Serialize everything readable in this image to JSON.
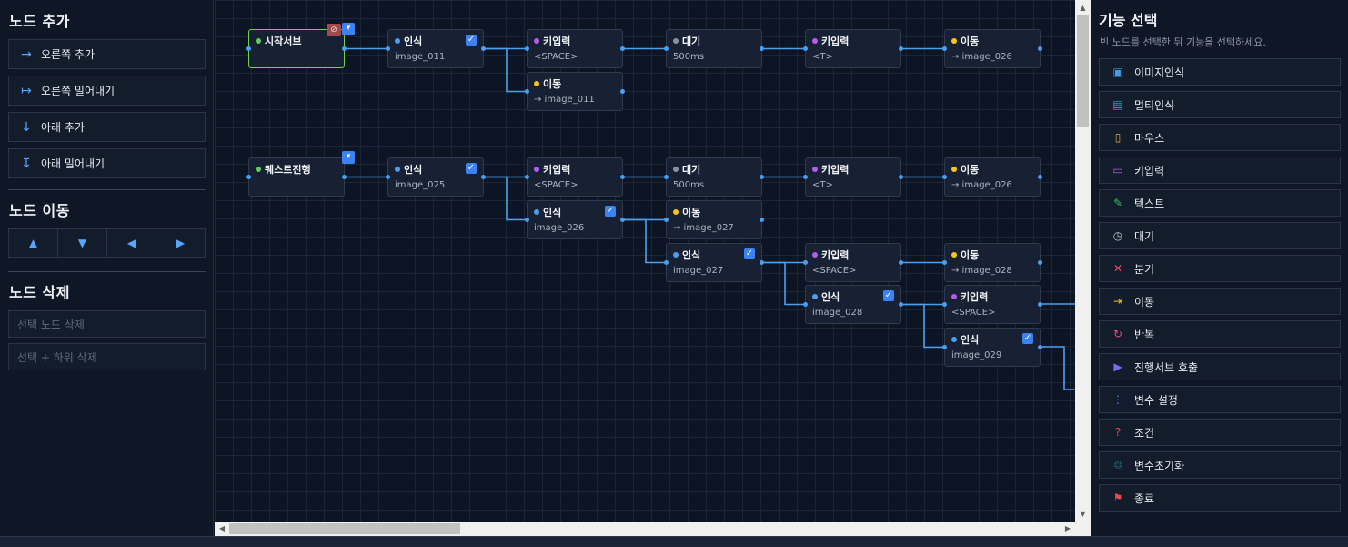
{
  "left": {
    "add_title": "노드 추가",
    "add_buttons": [
      {
        "icon": "arrow-right-icon",
        "glyph": "→",
        "label": "오른쪽 추가"
      },
      {
        "icon": "arrow-push-right-icon",
        "glyph": "↦",
        "label": "오른쪽 밀어내기"
      },
      {
        "icon": "arrow-down-icon",
        "glyph": "↓",
        "label": "아래 추가"
      },
      {
        "icon": "arrow-push-down-icon",
        "glyph": "↧",
        "label": "아래 밀어내기"
      }
    ],
    "move_title": "노드 이동",
    "move_buttons": [
      {
        "icon": "move-up-icon",
        "glyph": "▲"
      },
      {
        "icon": "move-down-icon",
        "glyph": "▼"
      },
      {
        "icon": "move-left-icon",
        "glyph": "◀"
      },
      {
        "icon": "move-right-icon",
        "glyph": "▶"
      }
    ],
    "delete_title": "노드 삭제",
    "delete_buttons": [
      "선택 노드 삭제",
      "선택 + 하위 삭제"
    ]
  },
  "canvas": {
    "colors": {
      "wire": "#4a9ff0",
      "green": "#5ad05a",
      "blue": "#4a9ff0",
      "purple": "#b45cf0",
      "gray": "#8a93a3",
      "yellow": "#f5c518"
    },
    "nodes": [
      {
        "id": "n1",
        "title": "시작서브",
        "sub": "",
        "dot": "green",
        "start": true,
        "check": false
      },
      {
        "id": "n2",
        "title": "인식",
        "sub": "image_011",
        "dot": "blue",
        "check": true
      },
      {
        "id": "n3",
        "title": "키입력",
        "sub": "<SPACE>",
        "dot": "purple",
        "check": false
      },
      {
        "id": "n4",
        "title": "대기",
        "sub": "500ms",
        "dot": "gray",
        "check": false
      },
      {
        "id": "n5",
        "title": "키입력",
        "sub": "<T>",
        "dot": "purple",
        "check": false
      },
      {
        "id": "n6",
        "title": "이동",
        "sub": "→ image_026",
        "dot": "yellow",
        "check": false
      },
      {
        "id": "n7",
        "title": "이동",
        "sub": "→ image_011",
        "dot": "yellow",
        "check": false
      },
      {
        "id": "n8",
        "title": "퀘스트진행",
        "sub": "",
        "dot": "green",
        "check": false
      },
      {
        "id": "n9",
        "title": "인식",
        "sub": "image_025",
        "dot": "blue",
        "check": true
      },
      {
        "id": "n10",
        "title": "키입력",
        "sub": "<SPACE>",
        "dot": "purple",
        "check": false
      },
      {
        "id": "n11",
        "title": "대기",
        "sub": "500ms",
        "dot": "gray",
        "check": false
      },
      {
        "id": "n12",
        "title": "키입력",
        "sub": "<T>",
        "dot": "purple",
        "check": false
      },
      {
        "id": "n13",
        "title": "이동",
        "sub": "→ image_026",
        "dot": "yellow",
        "check": false
      },
      {
        "id": "n14",
        "title": "인식",
        "sub": "image_026",
        "dot": "blue",
        "check": true
      },
      {
        "id": "n15",
        "title": "이동",
        "sub": "→ image_027",
        "dot": "yellow",
        "check": false
      },
      {
        "id": "n16",
        "title": "인식",
        "sub": "image_027",
        "dot": "blue",
        "check": true
      },
      {
        "id": "n17",
        "title": "키입력",
        "sub": "<SPACE>",
        "dot": "purple",
        "check": false
      },
      {
        "id": "n18",
        "title": "이동",
        "sub": "→ image_028",
        "dot": "yellow",
        "check": false
      },
      {
        "id": "n19",
        "title": "인식",
        "sub": "image_028",
        "dot": "blue",
        "check": true
      },
      {
        "id": "n20",
        "title": "키입력",
        "sub": "<SPACE>",
        "dot": "purple",
        "check": false
      },
      {
        "id": "n21",
        "title": "인식",
        "sub": "image_029",
        "dot": "blue",
        "check": true
      }
    ]
  },
  "right": {
    "title": "기능 선택",
    "hint": "빈 노드를 선택한 뒤 기능을 선택하세요.",
    "functions": [
      {
        "label": "이미지인식",
        "icon": "image-recognition-icon",
        "color": "#3b9fe8"
      },
      {
        "label": "멀티인식",
        "icon": "multi-recognition-icon",
        "color": "#2bb7d6"
      },
      {
        "label": "마우스",
        "icon": "mouse-icon",
        "color": "#e8a13b"
      },
      {
        "label": "키입력",
        "icon": "keyboard-icon",
        "color": "#b45cf0"
      },
      {
        "label": "텍스트",
        "icon": "text-icon",
        "color": "#3bbf6a"
      },
      {
        "label": "대기",
        "icon": "timer-icon",
        "color": "#c0c6d0"
      },
      {
        "label": "분기",
        "icon": "branch-icon",
        "color": "#e84a5f"
      },
      {
        "label": "이동",
        "icon": "goto-icon",
        "color": "#f5c518"
      },
      {
        "label": "반복",
        "icon": "loop-icon",
        "color": "#e84a8a"
      },
      {
        "label": "진행서브 호출",
        "icon": "call-sub-icon",
        "color": "#7b6cf0"
      },
      {
        "label": "변수 설정",
        "icon": "variable-icon",
        "color": "#3b82f6"
      },
      {
        "label": "조건",
        "icon": "condition-icon",
        "color": "#e84a4a"
      },
      {
        "label": "변수초기화",
        "icon": "reset-variable-icon",
        "color": "#2bb7d6"
      },
      {
        "label": "종료",
        "icon": "end-flag-icon",
        "color": "#e84a4a"
      }
    ]
  }
}
